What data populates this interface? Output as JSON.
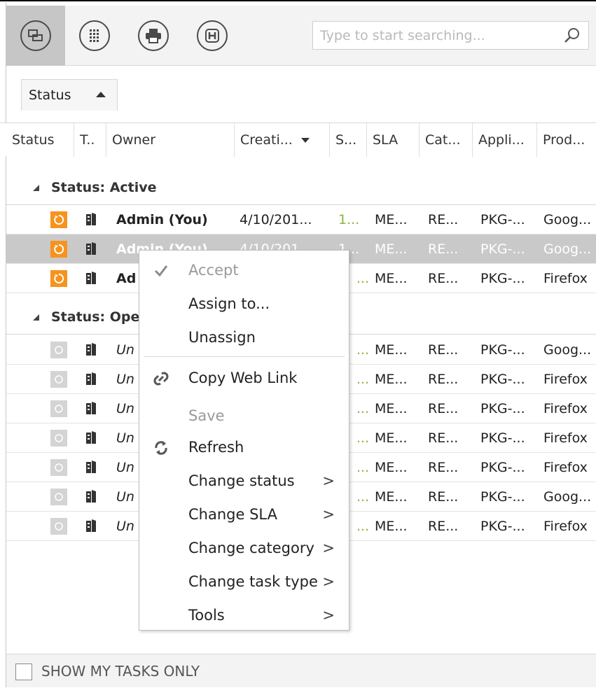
{
  "toolbar": {
    "buttons": [
      {
        "name": "view-toggle-icon"
      },
      {
        "name": "grid-icon"
      },
      {
        "name": "print-icon"
      },
      {
        "name": "help-icon"
      }
    ],
    "search_placeholder": "Type to start searching..."
  },
  "group_by": {
    "label": "Status"
  },
  "columns": [
    "Status",
    "T..",
    "Owner",
    "Creati...",
    "S...",
    "SLA",
    "Cat...",
    "Appli...",
    "Prod..."
  ],
  "groups": [
    {
      "label": "Status: Active",
      "rows": [
        {
          "owner": "Admin (You)",
          "created": "4/10/201...",
          "s": "1...",
          "sla": "ME...",
          "cat": "RE...",
          "app": "PKG-...",
          "prod": "Goog...",
          "selected": false
        },
        {
          "owner": "Admin (You)",
          "created": "4/10/201...",
          "s": "1...",
          "sla": "ME...",
          "cat": "RE...",
          "app": "PKG-...",
          "prod": "Goog...",
          "selected": true
        },
        {
          "owner": "Ad",
          "created": "",
          "s": "...",
          "sla": "ME...",
          "cat": "RE...",
          "app": "PKG-...",
          "prod": "Firefox",
          "selected": false
        }
      ]
    },
    {
      "label": "Status: Ope",
      "rows": [
        {
          "owner": "Un",
          "s": "...",
          "sla": "ME...",
          "cat": "RE...",
          "app": "PKG-...",
          "prod": "Goog..."
        },
        {
          "owner": "Un",
          "s": "...",
          "sla": "ME...",
          "cat": "RE...",
          "app": "PKG-...",
          "prod": "Firefox"
        },
        {
          "owner": "Un",
          "s": "...",
          "sla": "ME...",
          "cat": "RE...",
          "app": "PKG-...",
          "prod": "Firefox"
        },
        {
          "owner": "Un",
          "s": "...",
          "sla": "ME...",
          "cat": "RE...",
          "app": "PKG-...",
          "prod": "Firefox"
        },
        {
          "owner": "Un",
          "s": "...",
          "sla": "ME...",
          "cat": "RE...",
          "app": "PKG-...",
          "prod": "Firefox"
        },
        {
          "owner": "Un",
          "s": "...",
          "sla": "ME...",
          "cat": "RE...",
          "app": "PKG-...",
          "prod": "Goog..."
        },
        {
          "owner": "Un",
          "s": "...",
          "sla": "ME...",
          "cat": "RE...",
          "app": "PKG-...",
          "prod": "Firefox"
        }
      ]
    }
  ],
  "context_menu": {
    "items": [
      {
        "label": "Accept",
        "icon": "check-icon",
        "disabled": true
      },
      {
        "label": "Assign to...",
        "disabled": false
      },
      {
        "label": "Unassign",
        "disabled": false
      },
      {
        "label": "Copy Web Link",
        "icon": "link-icon",
        "disabled": false
      },
      {
        "label": "Save",
        "disabled": true
      },
      {
        "label": "Refresh",
        "icon": "refresh-icon",
        "disabled": false
      },
      {
        "label": "Change status",
        "submenu": true
      },
      {
        "label": "Change SLA",
        "submenu": true
      },
      {
        "label": "Change category",
        "submenu": true
      },
      {
        "label": "Change task type",
        "submenu": true
      },
      {
        "label": "Tools",
        "submenu": true
      }
    ],
    "submenu_glyph": ">"
  },
  "footer": {
    "label": "SHOW MY TASKS ONLY",
    "checked": false
  },
  "colors": {
    "active_status": "#f7931d",
    "selected_row": "#c9c9c9",
    "green_value": "#8db33c"
  }
}
